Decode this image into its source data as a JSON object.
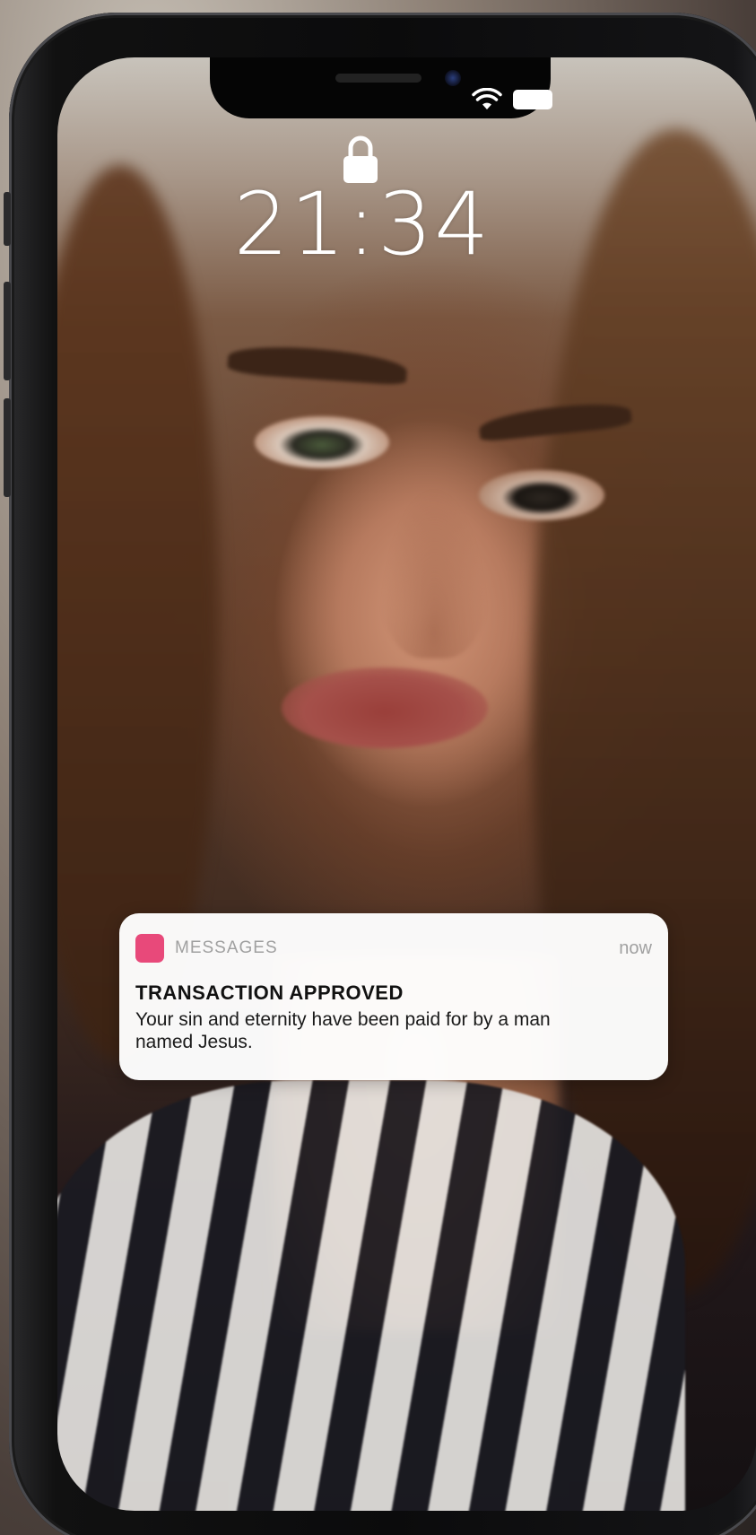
{
  "lock_screen": {
    "time": "21:34",
    "icons": {
      "lock": "lock-icon",
      "wifi": "wifi-icon",
      "battery": "battery-icon"
    }
  },
  "notification": {
    "app_name": "MESSAGES",
    "time": "now",
    "title": "TRANSACTION APPROVED",
    "body": "Your sin and eternity have been paid for by a man named Jesus.",
    "app_icon_color": "#e8497a"
  },
  "colors": {
    "notification_bg": "#ffffff",
    "clock_text": "#ffffff"
  }
}
